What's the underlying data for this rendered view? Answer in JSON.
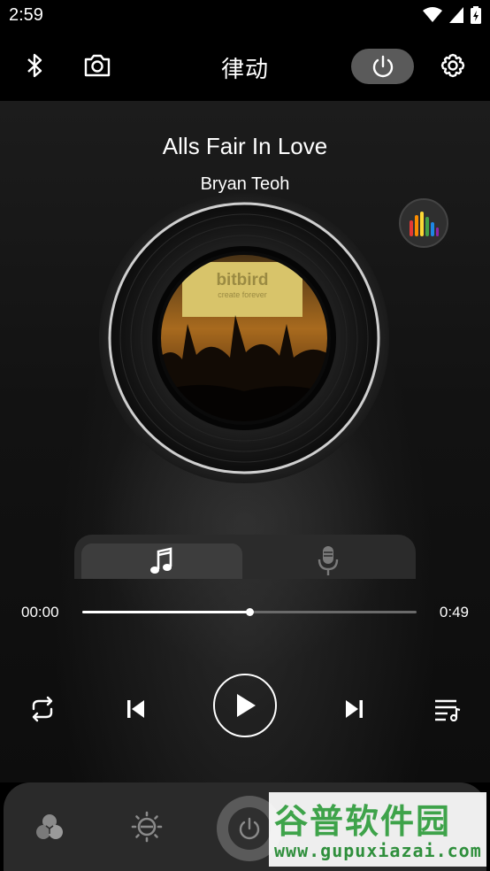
{
  "status_bar": {
    "time": "2:59"
  },
  "header": {
    "title": "律动"
  },
  "player": {
    "song_title": "Alls Fair In Love",
    "artist": "Bryan Teoh",
    "cover_text": {
      "line1": "bitbird",
      "line2": "create forever"
    },
    "progress": {
      "current": "00:00",
      "total": "0:49",
      "fraction": 0.5
    }
  },
  "watermark": {
    "brand": "谷普软件园",
    "url": "www.gupuxiazai.com"
  },
  "colors": {
    "accent_white": "#ffffff",
    "pill_grey": "#5a5a5a",
    "panel": "#2b2b2b",
    "watermark_green": "#3ea34a"
  },
  "icons": [
    "bluetooth-icon",
    "camera-icon",
    "power-icon",
    "gear-icon",
    "equalizer-icon",
    "music-note-icon",
    "microphone-icon",
    "repeat-icon",
    "previous-icon",
    "play-icon",
    "next-icon",
    "playlist-icon",
    "color-mix-icon",
    "brightness-icon"
  ]
}
